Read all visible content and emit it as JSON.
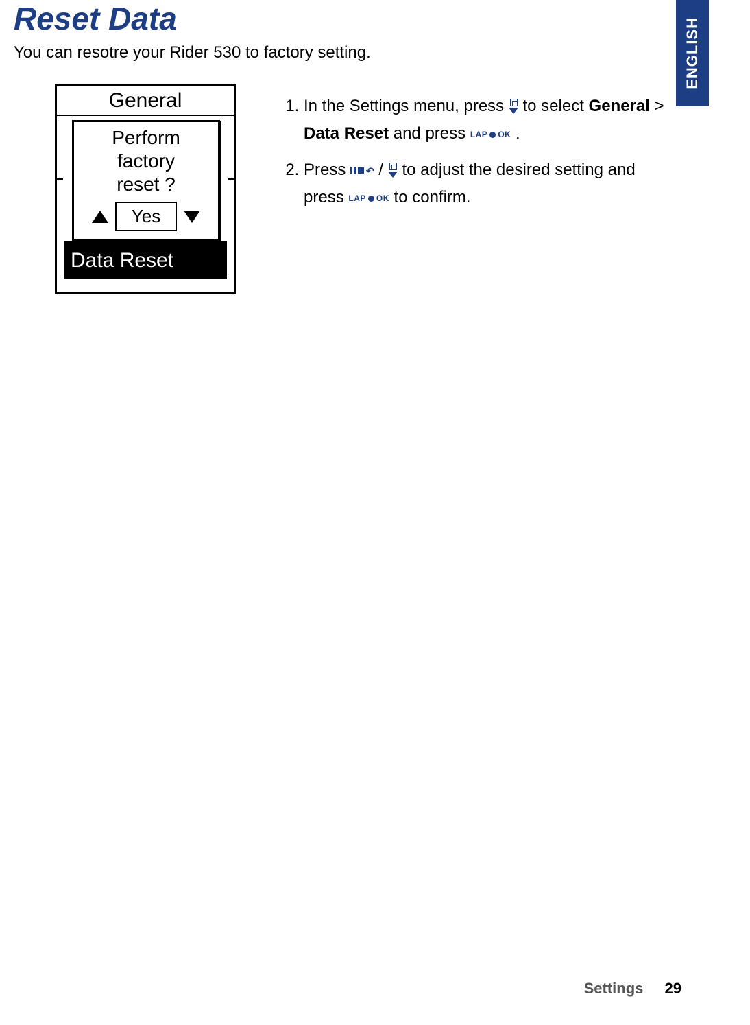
{
  "lang_tab": "ENGLISH",
  "title": "Reset Data",
  "intro": "You can resotre your Rider 530 to factory setting.",
  "device": {
    "title": "General",
    "menu_selected": "Data Reset",
    "dialog_line1": "Perform",
    "dialog_line2": "factory",
    "dialog_line3": "reset ?",
    "dialog_option": "Yes"
  },
  "steps": {
    "s1_a": "In the Settings menu, press ",
    "s1_b": " to select ",
    "s1_general": "General",
    "s1_gt": " > ",
    "s1_datareset": "Data Reset",
    "s1_c": " and press ",
    "s1_d": " .",
    "s2_a": "Press ",
    "s2_slash": " / ",
    "s2_b": " to adjust the desired setting and press ",
    "s2_c": " to confirm."
  },
  "icons": {
    "lap": "LAP",
    "ok": "OK"
  },
  "footer": {
    "section": "Settings",
    "page": "29"
  }
}
